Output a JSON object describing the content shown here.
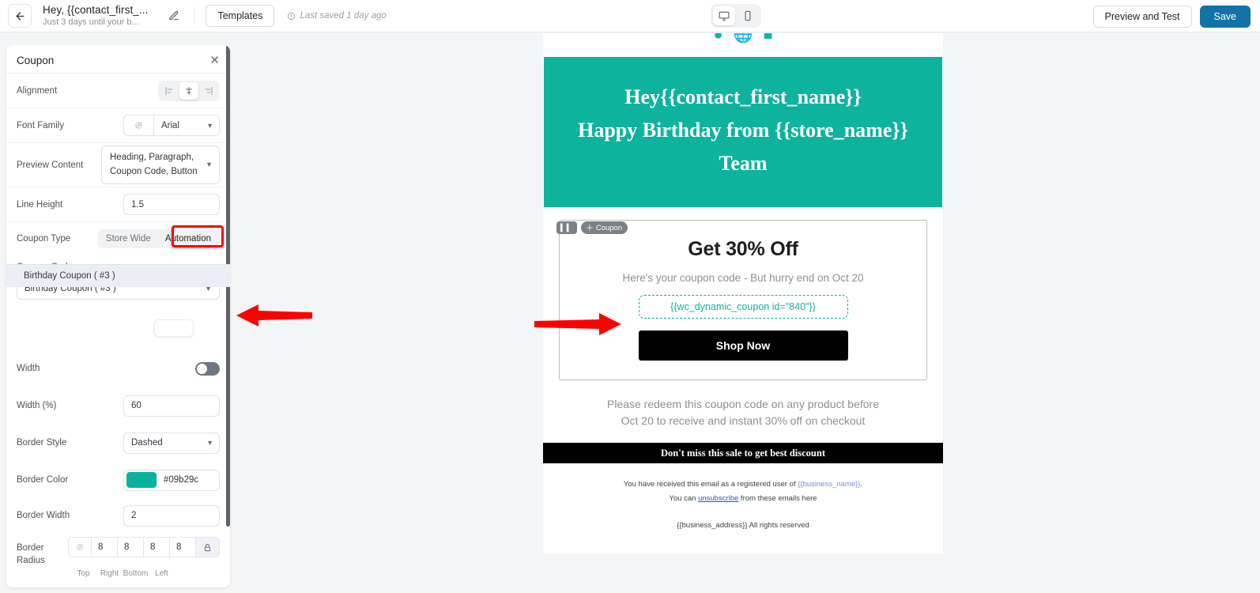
{
  "topbar": {
    "back_icon": "arrow-left-icon",
    "title": "Hey, {{contact_first_...",
    "subtitle": "Just 3 days until your b...",
    "edit_icon": "pencil-icon",
    "templates_label": "Templates",
    "clock_icon": "clock-icon",
    "saved_text": "Last saved 1 day ago",
    "device_desktop_icon": "desktop-icon",
    "device_mobile_icon": "mobile-icon",
    "preview_label": "Preview and Test",
    "save_label": "Save",
    "save_color": "#1173a8"
  },
  "panel": {
    "title": "Coupon",
    "close_icon": "close-icon",
    "alignment": {
      "label": "Alignment",
      "options": [
        "align-left-icon",
        "align-center-icon",
        "align-right-icon"
      ],
      "selected_index": 1
    },
    "font_family": {
      "label": "Font Family",
      "value": "Arial",
      "reset_icon": "no-style-icon"
    },
    "preview_content": {
      "label": "Preview Content",
      "value": "Heading, Paragraph, Coupon Code, Button"
    },
    "line_height": {
      "label": "Line Height",
      "value": "1.5"
    },
    "coupon_type": {
      "label": "Coupon Type",
      "options": [
        "Store Wide",
        "Automation"
      ],
      "selected": "Automation",
      "highlight_color": "#ff0000"
    },
    "coupon_code": {
      "label": "Coupon Code",
      "value": "Birthday Coupon ( #3 )",
      "dropdown_open": true,
      "options": [
        "Birthday Coupon ( #3 )"
      ]
    },
    "width_toggle": {
      "label": "Width",
      "on": false
    },
    "width_percent": {
      "label": "Width (%)",
      "value": "60"
    },
    "border_style": {
      "label": "Border Style",
      "value": "Dashed"
    },
    "border_color": {
      "label": "Border Color",
      "value": "#09b29c",
      "swatch": "#09b29c"
    },
    "border_width": {
      "label": "Border Width",
      "value": "2"
    },
    "border_radius": {
      "label": "Border Radius",
      "reset_icon": "no-style-icon",
      "values": [
        "8",
        "8",
        "8",
        "8"
      ],
      "captions": [
        "Top",
        "Right",
        "Bottom",
        "Left"
      ],
      "lock_icon": "lock-icon"
    }
  },
  "email": {
    "hero": {
      "line1": "Hey{{contact_first_name}}",
      "line2": "Happy Birthday from {{store_name}}",
      "line3": "Team",
      "bg": "#0eb39d"
    },
    "block_tools": {
      "grip_icon": "drag-columns-icon",
      "move_icon": "move-icon",
      "tag_label": "Coupon"
    },
    "coupon": {
      "heading": "Get 30% Off",
      "subheading": "Here's your coupon code - But hurry end on Oct 20",
      "code": "{{wc_dynamic_coupon id=\"840\"}}",
      "code_color": "#0eb39d",
      "button_label": "Shop Now"
    },
    "redeem_line1": "Please redeem this coupon code on any product before",
    "redeem_line2": "Oct 20 to receive and instant 30% off on checkout",
    "black_bar": "Don't miss this sale to get best discount",
    "footer": {
      "line1_pre": "You have received this email as a registered user of ",
      "line1_placeholder": "{{business_name}}",
      "line1_post": ".",
      "line2_pre": "You can ",
      "line2_link": "unsubscribe",
      "line2_post": " from these emails here",
      "line3": "{{business_address}}  All rights reserved"
    }
  },
  "annotations": {
    "arrow_color": "#ff0000",
    "left_arrow": "arrow-pointing-left-at-coupon-code-dropdown",
    "right_arrow": "arrow-pointing-right-at-coupon-code-field"
  }
}
